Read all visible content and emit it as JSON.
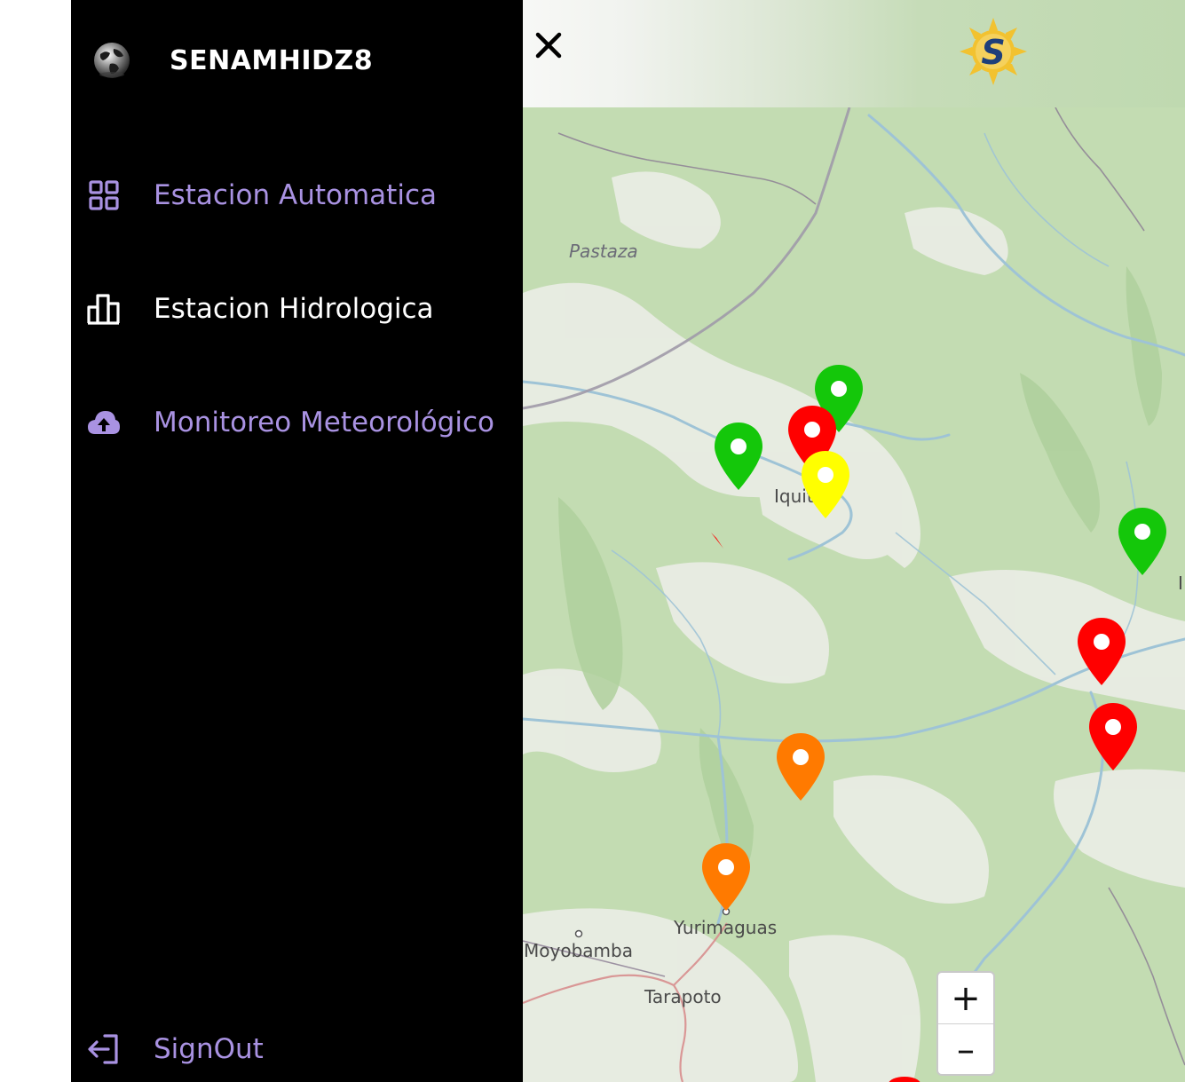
{
  "sidebar": {
    "brand": {
      "title": "SENAMHIDZ8"
    },
    "items": [
      {
        "label": "Estacion Automatica",
        "icon": "grid-icon",
        "color": "#a992e2",
        "active": false
      },
      {
        "label": "Estacion Hidrologica",
        "icon": "bar-chart-icon",
        "color": "#ffffff",
        "active": true
      },
      {
        "label": "Monitoreo Meteorológico",
        "icon": "cloud-upload-icon",
        "color": "#a992e2",
        "active": false
      }
    ],
    "signout": {
      "label": "SignOut",
      "icon": "sign-out-icon",
      "color": "#a992e2"
    }
  },
  "map": {
    "close_icon": "close-icon",
    "logo_letter": "S",
    "labels": {
      "pastaza": "Pastaza",
      "iquitos": "Iquitos",
      "yurimaguas": "Yurimaguas",
      "moyobamba": "Moyobamba",
      "tarapoto": "Tarapoto",
      "edge": "I"
    },
    "zoom": {
      "in": "+",
      "out": "–"
    },
    "markers": [
      {
        "color": "green"
      },
      {
        "color": "red"
      },
      {
        "color": "yellow"
      },
      {
        "color": "green"
      },
      {
        "color": "green"
      },
      {
        "color": "red"
      },
      {
        "color": "red"
      },
      {
        "color": "orange"
      },
      {
        "color": "orange"
      }
    ],
    "colors": {
      "green": "#14c70a",
      "red": "#ff0000",
      "yellow": "#ffff00",
      "orange": "#ff7a00"
    }
  }
}
